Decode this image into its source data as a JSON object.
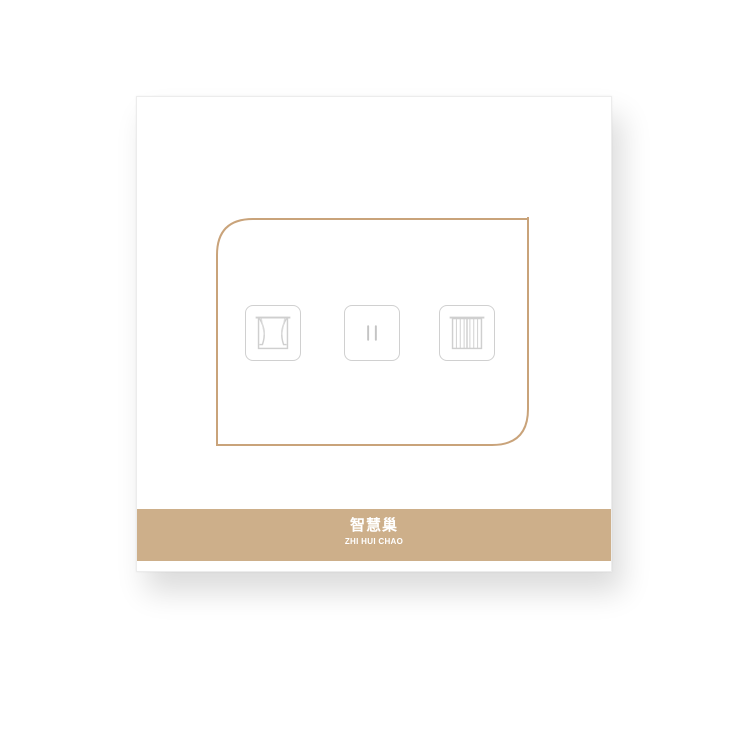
{
  "brand": {
    "name_cn": "智慧巢",
    "name_en": "ZHI HUI CHAO",
    "color": "#cdaf8a"
  },
  "frame": {
    "color": "#c9a37a"
  },
  "buttons": [
    {
      "icon": "curtain-open-icon"
    },
    {
      "icon": "pause-icon"
    },
    {
      "icon": "curtain-close-icon"
    }
  ]
}
